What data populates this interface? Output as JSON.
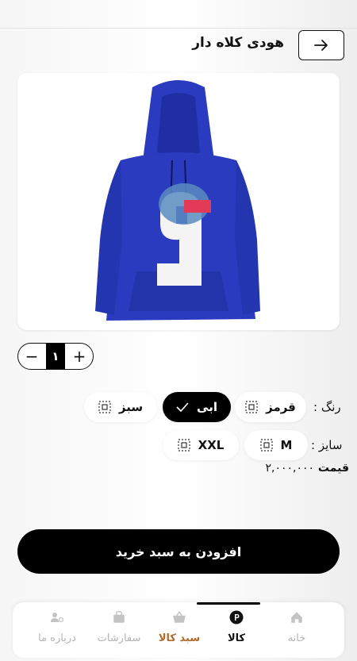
{
  "header": {
    "title": "هودی کلاه دار"
  },
  "quantity": {
    "value": "١",
    "minus": "−",
    "plus": "+"
  },
  "color": {
    "label": "رنگ :",
    "options": [
      {
        "label": "قرمز",
        "selected": false
      },
      {
        "label": "ابی",
        "selected": true
      },
      {
        "label": "سبز",
        "selected": false
      }
    ]
  },
  "size": {
    "label": "سایز :",
    "options": [
      {
        "label": "M"
      },
      {
        "label": "XXL"
      }
    ]
  },
  "price": {
    "label": "قیمت",
    "value": "۲,۰۰۰,۰۰۰"
  },
  "add_to_cart": "افزودن به سبد خرید",
  "nav": {
    "items": [
      {
        "label": "خانه",
        "icon": "home-icon"
      },
      {
        "label": "کالا",
        "icon": "product-icon"
      },
      {
        "label": "سبد کالا",
        "icon": "basket-icon"
      },
      {
        "label": "سفارشات",
        "icon": "orders-icon"
      },
      {
        "label": "درباره ما",
        "icon": "about-icon"
      }
    ]
  },
  "colors": {
    "accent": "#000000",
    "hoodie": "#2a3bbf",
    "cart_nav": "#b06a2a"
  }
}
